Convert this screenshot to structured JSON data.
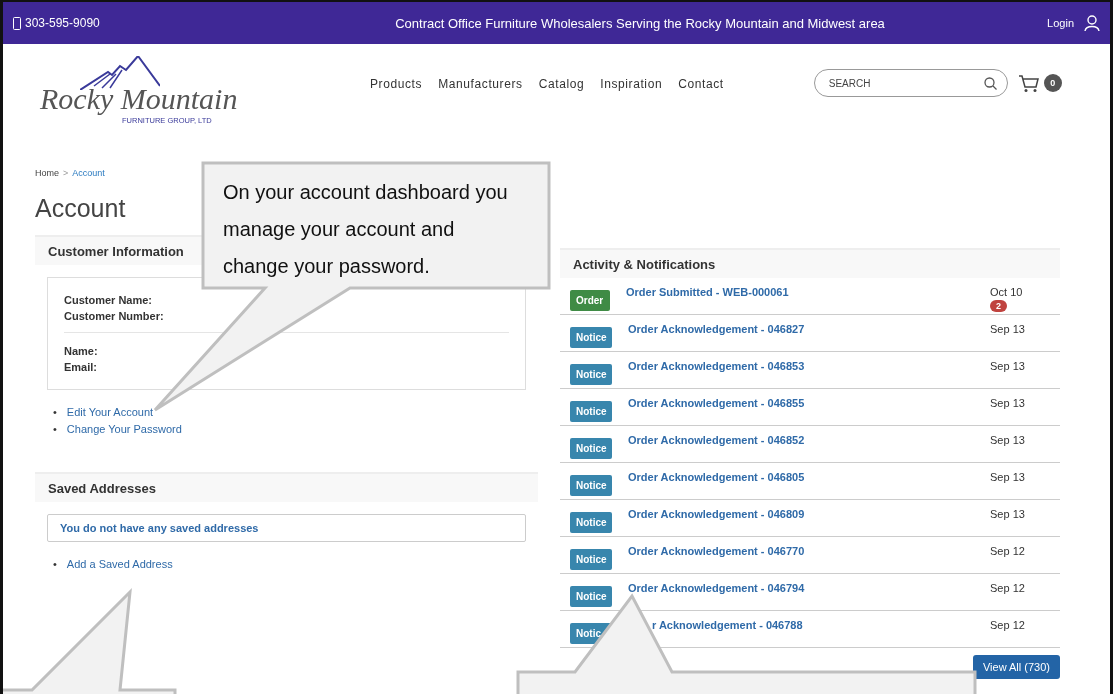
{
  "top_bar": {
    "phone": "303-595-9090",
    "tagline": "Contract Office Furniture Wholesalers Serving the Rocky Mountain and Midwest area",
    "login": "Login"
  },
  "logo": {
    "name": "Rocky Mountain",
    "subtitle": "FURNITURE GROUP, LTD"
  },
  "nav": [
    "Products",
    "Manufacturers",
    "Catalog",
    "Inspiration",
    "Contact"
  ],
  "search": {
    "placeholder": "SEARCH"
  },
  "cart": {
    "count": "0"
  },
  "breadcrumb": {
    "items": [
      {
        "label": "Home",
        "current": false
      },
      {
        "label": "Account",
        "current": true
      }
    ],
    "separator": ">"
  },
  "page_title": "Account",
  "customer_info": {
    "title": "Customer Information",
    "groups": [
      [
        "Customer Name:",
        "Customer Number:"
      ],
      [
        "Name:",
        "Email:"
      ]
    ],
    "links": [
      {
        "bullet": "•",
        "label": "Edit Your Account"
      },
      {
        "bullet": "•",
        "label": "Change Your Password"
      }
    ]
  },
  "saved_addresses": {
    "title": "Saved Addresses",
    "message": "You do not have any saved addresses",
    "links": [
      {
        "bullet": "•",
        "label": "Add a Saved Address"
      }
    ]
  },
  "activity": {
    "title": "Activity & Notifications",
    "items": [
      {
        "kind": "order",
        "badge": "Order",
        "title": "Order Submitted - WEB-000061",
        "date": "Oct 10",
        "count": "2"
      },
      {
        "kind": "notice",
        "badge": "Notice",
        "title": "Order Acknowledgement - 046827",
        "date": "Sep 13"
      },
      {
        "kind": "notice",
        "badge": "Notice",
        "title": "Order Acknowledgement - 046853",
        "date": "Sep 13"
      },
      {
        "kind": "notice",
        "badge": "Notice",
        "title": "Order Acknowledgement - 046855",
        "date": "Sep 13"
      },
      {
        "kind": "notice",
        "badge": "Notice",
        "title": "Order Acknowledgement - 046852",
        "date": "Sep 13"
      },
      {
        "kind": "notice",
        "badge": "Notice",
        "title": "Order Acknowledgement - 046805",
        "date": "Sep 13"
      },
      {
        "kind": "notice",
        "badge": "Notice",
        "title": "Order Acknowledgement - 046809",
        "date": "Sep 13"
      },
      {
        "kind": "notice",
        "badge": "Notice",
        "title": "Order Acknowledgement - 046770",
        "date": "Sep 12"
      },
      {
        "kind": "notice",
        "badge": "Notice",
        "title": "Order Acknowledgement - 046794",
        "date": "Sep 12"
      },
      {
        "kind": "notice",
        "badge": "Notic",
        "title": "r Acknowledgement - 046788",
        "date": "Sep 12"
      }
    ],
    "view_all": "View All (730)"
  },
  "callout": {
    "text": "On your account dashboard you manage your account and change your password."
  }
}
